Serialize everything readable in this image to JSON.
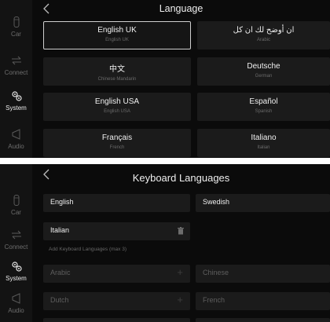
{
  "screen1": {
    "title": "Language",
    "sidebar": [
      {
        "label": "Car",
        "icon": "car-icon"
      },
      {
        "label": "Connect",
        "icon": "connect-arrows-icon"
      },
      {
        "label": "System",
        "icon": "gears-icon",
        "active": true
      },
      {
        "label": "Audio",
        "icon": "speaker-icon"
      }
    ],
    "languages": [
      {
        "name": "English UK",
        "sub": "English UK",
        "selected": true
      },
      {
        "name": "ان أوضح لك ان كل",
        "sub": "Arabic"
      },
      {
        "name": "中文",
        "sub": "Chinese Mandarin"
      },
      {
        "name": "Deutsche",
        "sub": "German"
      },
      {
        "name": "English USA",
        "sub": "English USA"
      },
      {
        "name": "Español",
        "sub": "Spanish"
      },
      {
        "name": "Français",
        "sub": "French"
      },
      {
        "name": "Italiano",
        "sub": "Italian"
      }
    ]
  },
  "screen2": {
    "title": "Keyboard Languages",
    "sidebar": [
      {
        "label": "Car",
        "icon": "car-icon"
      },
      {
        "label": "Connect",
        "icon": "connect-arrows-icon"
      },
      {
        "label": "System",
        "icon": "gears-icon",
        "active": true
      },
      {
        "label": "Audio",
        "icon": "speaker-icon"
      }
    ],
    "active_keyboards": [
      "English",
      "Swedish",
      "Italian"
    ],
    "add_label": "Add Keyboard Languages (max 3)",
    "available": [
      "Arabic",
      "Chinese",
      "Dutch",
      "French"
    ],
    "plus_glyph": "+"
  }
}
